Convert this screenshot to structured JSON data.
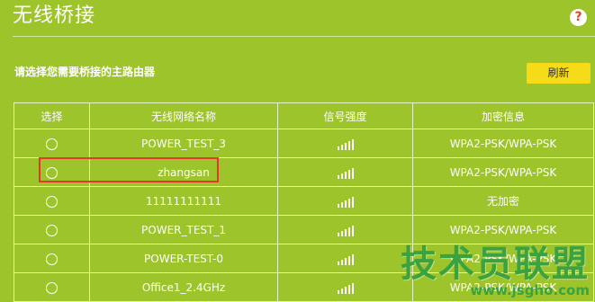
{
  "page": {
    "title": "无线桥接",
    "help_icon": "question-icon",
    "help_symbol": "?"
  },
  "instruction": "请选择您需要桥接的主路由器",
  "refresh_label": "刷新",
  "table": {
    "headers": [
      "选择",
      "无线网络名称",
      "信号强度",
      "加密信息"
    ],
    "rows": [
      {
        "ssid": "POWER_TEST_3",
        "signal_bars": 5,
        "encryption": "WPA2-PSK/WPA-PSK"
      },
      {
        "ssid": "zhangsan",
        "signal_bars": 5,
        "encryption": "WPA2-PSK/WPA-PSK"
      },
      {
        "ssid": "11111111111",
        "signal_bars": 5,
        "encryption": "无加密"
      },
      {
        "ssid": "POWER_TEST_1",
        "signal_bars": 5,
        "encryption": "WPA2-PSK/WPA-PSK"
      },
      {
        "ssid": "POWER-TEST-0",
        "signal_bars": 5,
        "encryption": "WPA2-PSK/WPA-PSK"
      },
      {
        "ssid": "Office1_2.4GHz",
        "signal_bars": 5,
        "encryption": "WPA2-PSK/WPA-PSK"
      }
    ]
  },
  "watermark": {
    "text": "技术员联盟",
    "url": "www.jsgho.com"
  },
  "colors": {
    "background": "#9dc42b",
    "refresh_button": "#f6dc18",
    "highlight_border": "#e3372a",
    "watermark": "#3aa23e"
  }
}
